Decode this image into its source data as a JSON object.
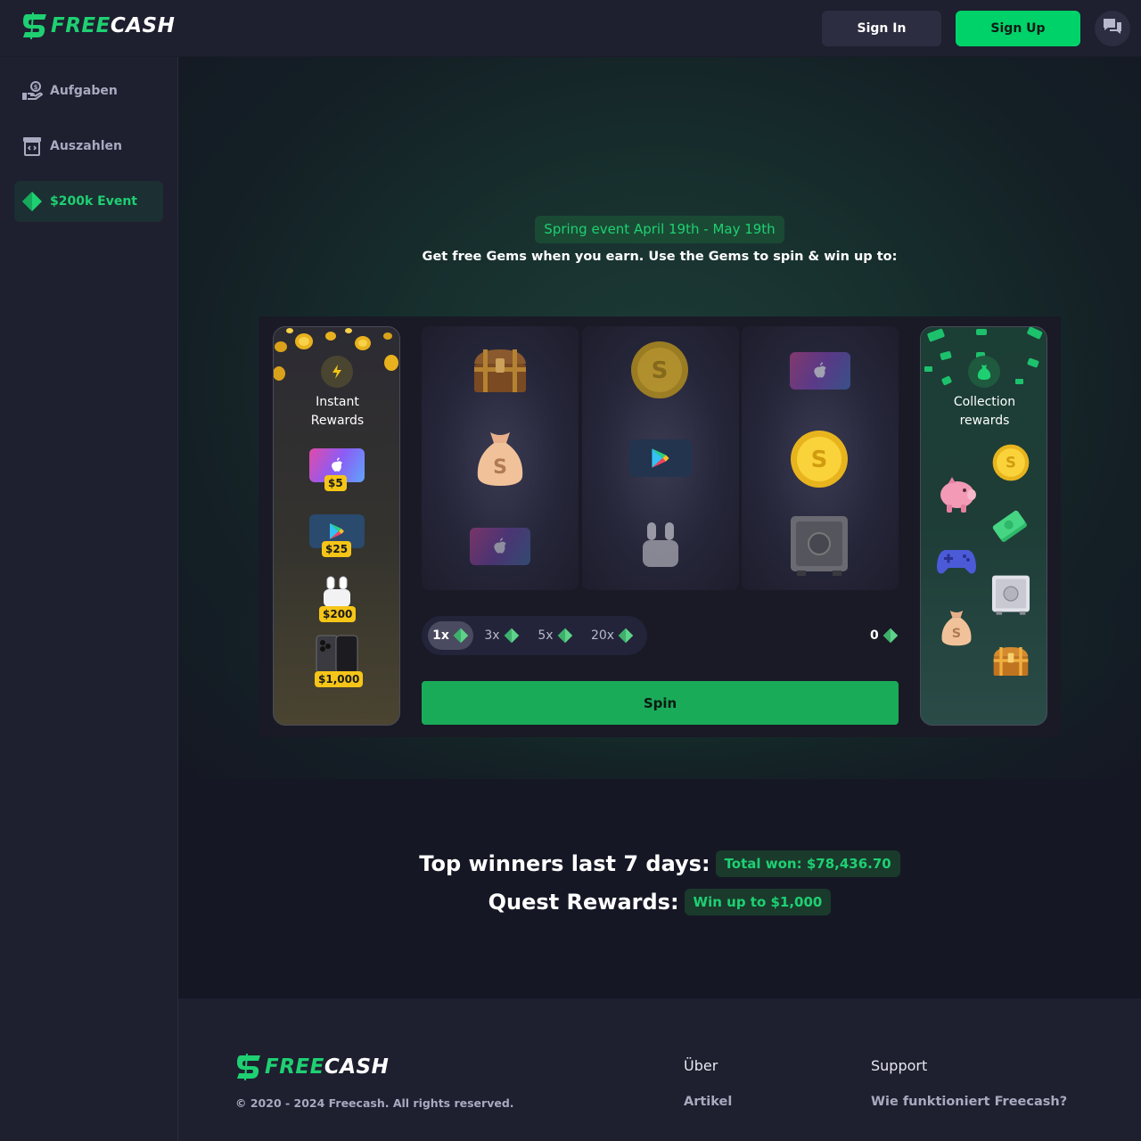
{
  "header": {
    "logo_free": "FREE",
    "logo_cash": "CASH",
    "signin_label": "Sign In",
    "signup_label": "Sign Up",
    "chat_icon": "chat-icon"
  },
  "sidebar": {
    "items": [
      {
        "label": "Aufgaben",
        "icon": "hand-coin-icon"
      },
      {
        "label": "Auszahlen",
        "icon": "cashout-icon"
      },
      {
        "label": "$200k Event",
        "icon": "gem-icon",
        "active": true
      }
    ]
  },
  "hero": {
    "event_badge": "Spring event April 19th - May 19th",
    "subtitle": "Get free Gems when you earn. Use the Gems to spin & win up to:"
  },
  "instant_rewards": {
    "title_line1": "Instant",
    "title_line2": "Rewards",
    "prizes": [
      {
        "icon": "apple-gift-card-icon",
        "price": "$5"
      },
      {
        "icon": "google-play-card-icon",
        "price": "$25"
      },
      {
        "icon": "airpods-icon",
        "price": "$200"
      },
      {
        "icon": "iphone-icon",
        "price": "$1,000"
      }
    ]
  },
  "reels": [
    [
      "treasure-chest-icon",
      "money-bag-icon",
      "apple-gift-card-icon"
    ],
    [
      "gold-coin-icon",
      "google-play-card-icon",
      "airpods-icon"
    ],
    [
      "apple-gift-card-icon",
      "gold-coin-icon",
      "safe-icon"
    ]
  ],
  "multipliers": [
    {
      "label": "1x",
      "selected": true
    },
    {
      "label": "3x",
      "selected": false
    },
    {
      "label": "5x",
      "selected": false
    },
    {
      "label": "20x",
      "selected": false
    }
  ],
  "gem_balance": "0",
  "spin_label": "Spin",
  "collection_rewards": {
    "title_line1": "Collection",
    "title_line2": "rewards",
    "items": [
      "gold-coin-icon",
      "piggy-bank-icon",
      "cash-stack-icon",
      "gamepad-icon",
      "safe-icon",
      "money-bag-icon",
      "treasure-chest-icon"
    ]
  },
  "winners": {
    "title": "Top winners last 7 days:",
    "total_badge": "Total won: $78,436.70",
    "quest_title": "Quest Rewards:",
    "quest_badge": "Win up to $1,000"
  },
  "footer": {
    "logo_free": "FREE",
    "logo_cash": "CASH",
    "copyright": "© 2020 - 2024 Freecash. All rights reserved.",
    "col1_head": "Über",
    "col1_link1": "Artikel",
    "col2_head": "Support",
    "col2_link1": "Wie funktioniert Freecash?"
  },
  "colors": {
    "brand_green": "#1ed072",
    "spin_green": "#1aab59",
    "gold": "#f5c518"
  }
}
